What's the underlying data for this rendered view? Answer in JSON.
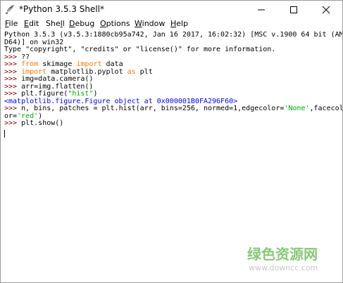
{
  "window": {
    "title": "*Python 3.5.3 Shell*"
  },
  "menu": {
    "items": [
      {
        "acc": "F",
        "rest": "ile"
      },
      {
        "acc": "E",
        "rest": "dit"
      },
      {
        "pre": "She",
        "acc": "l",
        "rest": "l"
      },
      {
        "acc": "D",
        "rest": "ebug"
      },
      {
        "acc": "O",
        "rest": "ptions"
      },
      {
        "acc": "W",
        "rest": "indow"
      },
      {
        "acc": "H",
        "rest": "elp"
      }
    ]
  },
  "shell": {
    "banner1": "Python 3.5.3 (v3.5.3:1880cb95a742, Jan 16 2017, 16:02:32) [MSC v.1900 64 bit (AM",
    "banner2": "D64)] on win32",
    "banner3": "Type \"copyright\", \"credits\" or \"license()\" for more information.",
    "prompt": ">>> ",
    "l1_text": "??",
    "l2_kw1": "from",
    "l2_mid": " skimage ",
    "l2_kw2": "import",
    "l2_end": " data",
    "l3_kw1": "import",
    "l3_mid": " matplotlib.pyplot ",
    "l3_kw2": "as",
    "l3_end": " plt",
    "l4_text": "img=data.camera()",
    "l5_text": "arr=img.flatten()",
    "l6_pre": "plt.figure(",
    "l6_str": "\"hist\"",
    "l6_post": ")",
    "output": "<matplotlib.figure.Figure object at 0x000001B0FA296F60>",
    "l7_pre": "n, bins, patches = plt.hist(arr, bins=256, normed=1,edgecolor=",
    "l7_str": "'None'",
    "l7_post": ",facecol",
    "l8_pre": "or=",
    "l8_str": "'red'",
    "l8_post": ")",
    "l9_text": "plt.show()"
  },
  "watermark": {
    "logo": "绿色资源网",
    "url": "www.downcc.com"
  },
  "colors": {
    "prompt": "#770000",
    "keyword": "#ff7700",
    "string": "#00aa00",
    "output": "#0000ff"
  },
  "icons": {
    "app": "python-feather-icon",
    "minimize": "minimize-icon",
    "maximize": "maximize-icon",
    "close": "close-icon"
  }
}
